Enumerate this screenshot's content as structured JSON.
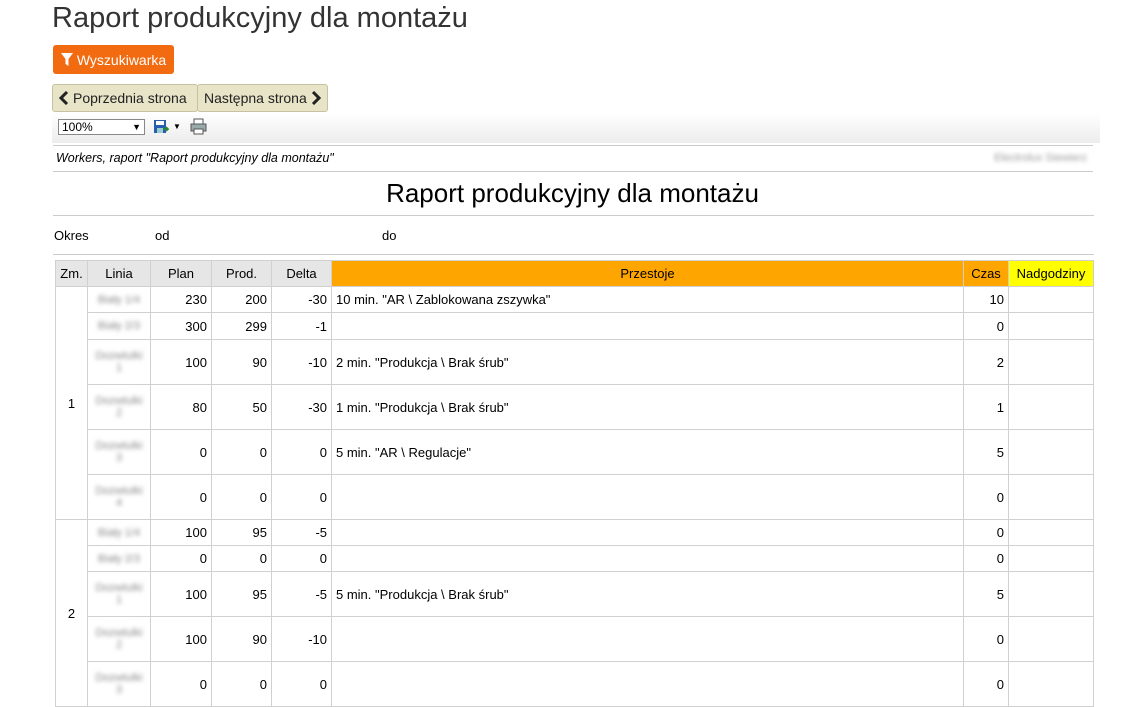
{
  "page": {
    "title": "Raport produkcyjny dla montażu"
  },
  "buttons": {
    "search": "Wyszukiwarka",
    "prev": "Poprzednia strona",
    "next": "Następna strona"
  },
  "toolbar": {
    "zoom": "100%"
  },
  "report": {
    "header_left": "Workers, raport \"Raport produkcyjny dla montażu\"",
    "header_right": "Electrolux Siewierz",
    "title": "Raport produkcyjny dla montażu",
    "period_label": "Okres",
    "from_label": "od",
    "to_label": "do"
  },
  "table": {
    "columns": {
      "zm": "Zm.",
      "linia": "Linia",
      "plan": "Plan",
      "prod": "Prod.",
      "delta": "Delta",
      "przestoje": "Przestoje",
      "czas": "Czas",
      "nadgodziny": "Nadgodziny"
    },
    "shifts": [
      {
        "shift": "1",
        "rows": [
          {
            "line": "Biały 1/4",
            "plan": "230",
            "prod": "200",
            "delta": "-30",
            "downtime": "10 min. \"AR \\ Zablokowana zszywka\"",
            "time": "10",
            "overtime": ""
          },
          {
            "line": "Biały 2/3",
            "plan": "300",
            "prod": "299",
            "delta": "-1",
            "downtime": "",
            "time": "0",
            "overtime": ""
          },
          {
            "line": "Dozwtulki 1",
            "plan": "100",
            "prod": "90",
            "delta": "-10",
            "downtime": "2 min. \"Produkcja \\ Brak śrub\"",
            "time": "2",
            "overtime": ""
          },
          {
            "line": "Dozwtulki 2",
            "plan": "80",
            "prod": "50",
            "delta": "-30",
            "downtime": "1 min. \"Produkcja \\ Brak śrub\"",
            "time": "1",
            "overtime": ""
          },
          {
            "line": "Dozwtulki 3",
            "plan": "0",
            "prod": "0",
            "delta": "0",
            "downtime": "5 min. \"AR \\ Regulacje\"",
            "time": "5",
            "overtime": ""
          },
          {
            "line": "Dozwtulki 4",
            "plan": "0",
            "prod": "0",
            "delta": "0",
            "downtime": "",
            "time": "0",
            "overtime": ""
          }
        ]
      },
      {
        "shift": "2",
        "rows": [
          {
            "line": "Biały 1/4",
            "plan": "100",
            "prod": "95",
            "delta": "-5",
            "downtime": "",
            "time": "0",
            "overtime": ""
          },
          {
            "line": "Biały 2/3",
            "plan": "0",
            "prod": "0",
            "delta": "0",
            "downtime": "",
            "time": "0",
            "overtime": ""
          },
          {
            "line": "Dozwtulki 1",
            "plan": "100",
            "prod": "95",
            "delta": "-5",
            "downtime": "5 min. \"Produkcja \\ Brak śrub\"",
            "time": "5",
            "overtime": ""
          },
          {
            "line": "Dozwtulki 2",
            "plan": "100",
            "prod": "90",
            "delta": "-10",
            "downtime": "",
            "time": "0",
            "overtime": ""
          },
          {
            "line": "Dozwtulki 3",
            "plan": "0",
            "prod": "0",
            "delta": "0",
            "downtime": "",
            "time": "0",
            "overtime": ""
          }
        ]
      }
    ]
  },
  "colors": {
    "accent": "#f26b10",
    "downtime_header": "#ffa500",
    "overtime_header": "#ffff00"
  },
  "icons": {
    "search": "filter-icon",
    "prev": "chevron-left-icon",
    "next": "chevron-right-icon",
    "save": "save-icon",
    "print": "print-icon"
  }
}
